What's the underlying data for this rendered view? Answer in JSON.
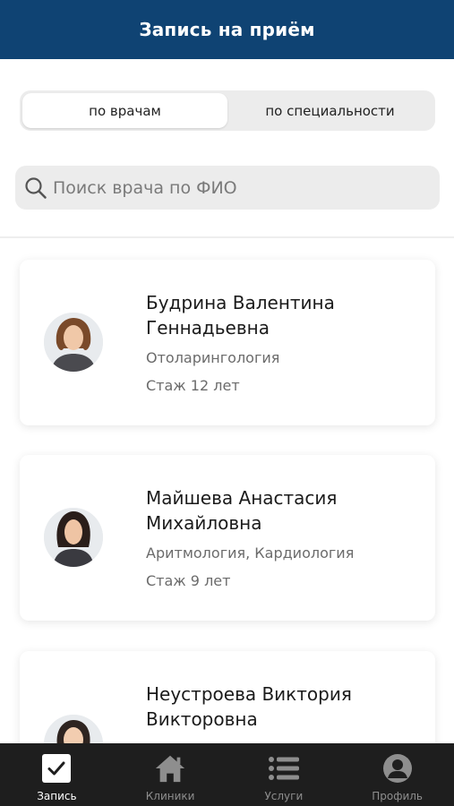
{
  "header": {
    "title": "Запись на приём"
  },
  "tabs": [
    {
      "label": "по врачам",
      "active": true
    },
    {
      "label": "по специальности",
      "active": false
    }
  ],
  "search": {
    "placeholder": "Поиск врача по ФИО",
    "value": ""
  },
  "doctors": [
    {
      "name": "Будрина Валентина Геннадьевна",
      "specialty": "Отоларингология",
      "experience": "Стаж 12 лет"
    },
    {
      "name": "Майшева Анастасия Михайловна",
      "specialty": "Аритмология, Кардиология",
      "experience": "Стаж 9 лет"
    },
    {
      "name": "Неустроева Виктория Викторовна",
      "specialty": "",
      "experience": ""
    }
  ],
  "bottom_nav": [
    {
      "label": "Запись",
      "icon": "checkbox-icon",
      "active": true
    },
    {
      "label": "Клиники",
      "icon": "home-icon",
      "active": false
    },
    {
      "label": "Услуги",
      "icon": "list-icon",
      "active": false
    },
    {
      "label": "Профиль",
      "icon": "profile-icon",
      "active": false
    }
  ],
  "colors": {
    "header": "#0f4373",
    "nav_background": "#1e1e1e",
    "nav_active": "#ffffff",
    "nav_inactive": "#8e8e8e"
  }
}
